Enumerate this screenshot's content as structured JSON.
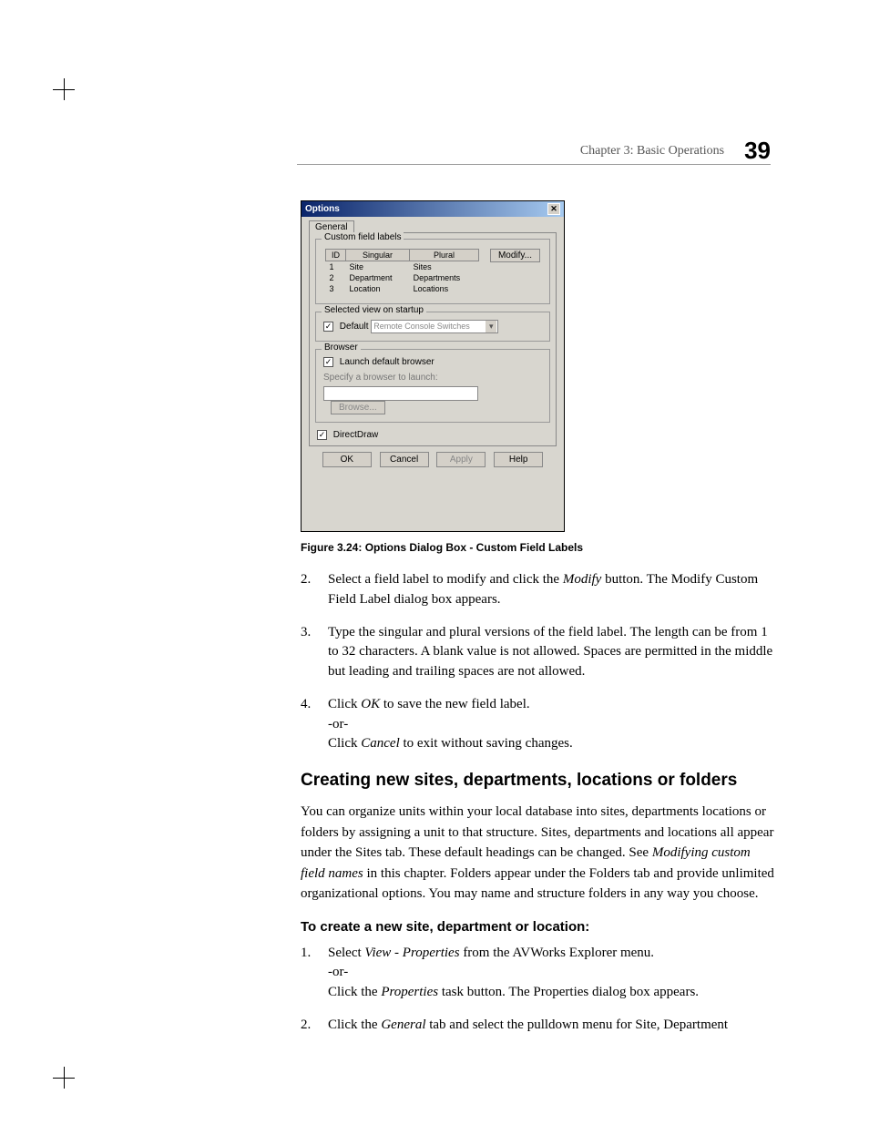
{
  "header": {
    "chapter": "Chapter 3: Basic Operations",
    "page_number": "39"
  },
  "dialog": {
    "title": "Options",
    "close_glyph": "✕",
    "tab_label": "General",
    "group_custom": "Custom field labels",
    "table": {
      "headers": {
        "id": "ID",
        "singular": "Singular",
        "plural": "Plural"
      },
      "rows": [
        {
          "id": "1",
          "singular": "Site",
          "plural": "Sites"
        },
        {
          "id": "2",
          "singular": "Department",
          "plural": "Departments"
        },
        {
          "id": "3",
          "singular": "Location",
          "plural": "Locations"
        }
      ]
    },
    "modify_btn": "Modify...",
    "group_startup": "Selected view on startup",
    "default_chk": "Default",
    "startup_dropdown": "Remote Console Switches",
    "group_browser": "Browser",
    "launch_default_chk": "Launch default browser",
    "specify_label": "Specify a browser to launch:",
    "browse_btn": "Browse...",
    "directdraw_chk": "DirectDraw",
    "buttons": {
      "ok": "OK",
      "cancel": "Cancel",
      "apply": "Apply",
      "help": "Help"
    }
  },
  "figure_caption": "Figure 3.24: Options Dialog Box - Custom Field Labels",
  "steps_a": [
    {
      "num": "2.",
      "text_pre": "Select a field label to modify and click the ",
      "italic": "Modify",
      "text_post": " button. The Modify Custom Field Label dialog box appears."
    },
    {
      "num": "3.",
      "text_pre": "Type the singular and plural versions of the field label. The length can be from 1 to 32 characters. A blank value is not allowed. Spaces are permitted in the middle but leading and trailing spaces are not allowed.",
      "italic": "",
      "text_post": ""
    },
    {
      "num": "4.",
      "text_pre": "Click ",
      "italic": "OK",
      "text_post": " to save the new field label.",
      "or": "-or-",
      "line2_pre": "Click ",
      "line2_italic": "Cancel",
      "line2_post": " to exit without saving changes."
    }
  ],
  "section_heading": "Creating new sites, departments, locations or folders",
  "body_para_pre": "You can organize units within your local database into sites, departments locations or folders by assigning a unit to that structure. Sites, departments and locations all appear under the Sites tab. These default headings can be changed. See ",
  "body_para_italic": "Modifying custom field names",
  "body_para_post": " in this chapter. Folders appear under the Folders tab and provide unlimited organizational options. You may name and structure folders in any way you choose.",
  "sub_heading": "To create a new site, department or location:",
  "steps_b": [
    {
      "num": "1.",
      "text_pre": "Select ",
      "italic": "View - Properties",
      "text_post": " from the AVWorks Explorer menu.",
      "or": "-or-",
      "line2_pre": "Click the ",
      "line2_italic": "Properties",
      "line2_post": " task button. The Properties dialog box appears."
    },
    {
      "num": "2.",
      "text_pre": "Click the ",
      "italic": "General",
      "text_post": " tab and select the pulldown menu for Site, Department"
    }
  ]
}
